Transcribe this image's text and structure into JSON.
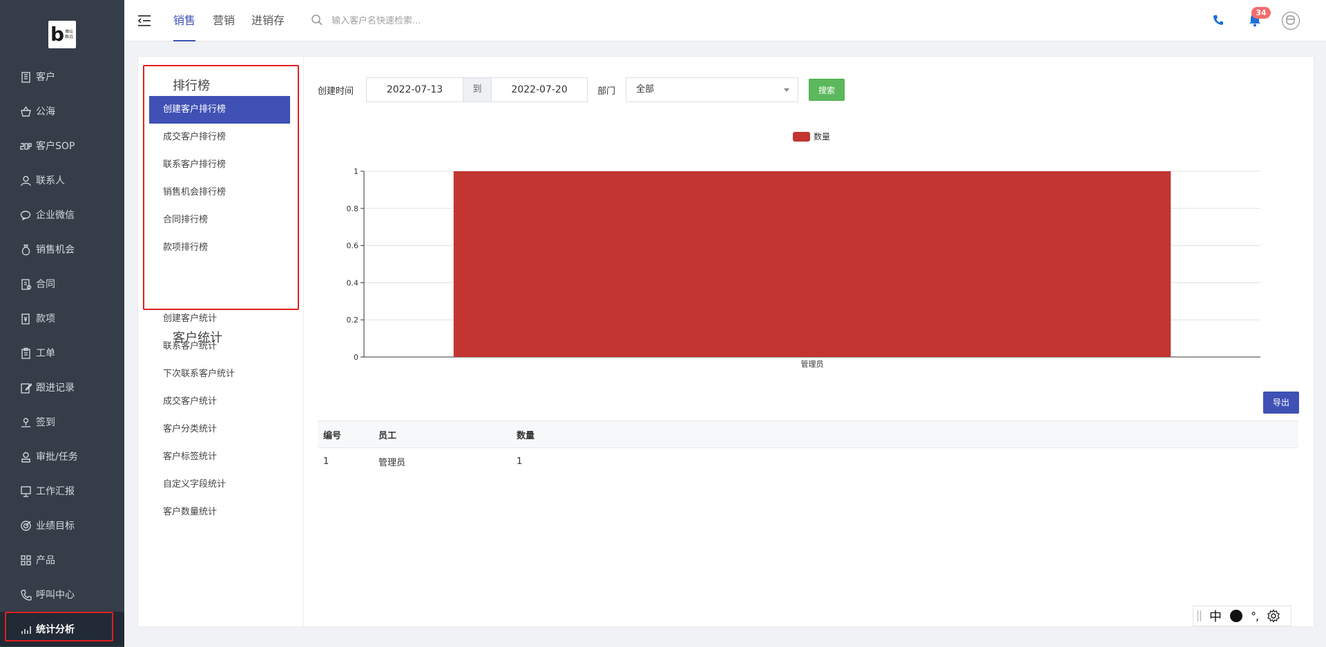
{
  "brand": {
    "logo_text": "博众致远"
  },
  "sidebar": {
    "items": [
      {
        "label": "客户",
        "icon": "building-icon"
      },
      {
        "label": "公海",
        "icon": "basket-icon"
      },
      {
        "label": "客户SOP",
        "icon": "sop-icon"
      },
      {
        "label": "联系人",
        "icon": "person-icon"
      },
      {
        "label": "企业微信",
        "icon": "wechat-icon"
      },
      {
        "label": "销售机会",
        "icon": "money-bag-icon"
      },
      {
        "label": "合同",
        "icon": "contract-icon"
      },
      {
        "label": "款项",
        "icon": "payment-icon"
      },
      {
        "label": "工单",
        "icon": "clipboard-icon"
      },
      {
        "label": "跟进记录",
        "icon": "edit-icon"
      },
      {
        "label": "签到",
        "icon": "location-icon"
      },
      {
        "label": "审批/任务",
        "icon": "approval-icon"
      },
      {
        "label": "工作汇报",
        "icon": "presentation-icon"
      },
      {
        "label": "业绩目标",
        "icon": "target-icon"
      },
      {
        "label": "产品",
        "icon": "grid-icon"
      },
      {
        "label": "呼叫中心",
        "icon": "phone-icon"
      },
      {
        "label": "统计分析",
        "icon": "bar-chart-icon",
        "active": true
      }
    ]
  },
  "topbar": {
    "tabs": [
      {
        "label": "销售",
        "active": true
      },
      {
        "label": "营销",
        "active": false
      },
      {
        "label": "进销存",
        "active": false
      }
    ],
    "search_placeholder": "输入客户名快速检索...",
    "notification_count": "34"
  },
  "left_panel": {
    "ranking_title": "排行榜",
    "ranking_items": [
      "创建客户排行榜",
      "成交客户排行榜",
      "联系客户排行榜",
      "销售机会排行榜",
      "合同排行榜",
      "款项排行榜"
    ],
    "active_ranking": 0,
    "stats_title": "客户统计",
    "stats_items": [
      "创建客户统计",
      "联系客户统计",
      "下次联系客户统计",
      "成交客户统计",
      "客户分类统计",
      "客户标签统计",
      "自定义字段统计",
      "客户数量统计"
    ]
  },
  "filters": {
    "created_label": "创建时间",
    "start_date": "2022-07-13",
    "range_sep": "到",
    "end_date": "2022-07-20",
    "dept_label": "部门",
    "dept_value": "全部",
    "search_button": "搜索"
  },
  "chart_data": {
    "type": "bar",
    "categories": [
      "管理员"
    ],
    "series": [
      {
        "name": "数量",
        "values": [
          1
        ],
        "color": "#c23531"
      }
    ],
    "ylim": [
      0,
      1
    ],
    "yticks": [
      "0",
      "0.2",
      "0.4",
      "0.6",
      "0.8",
      "1"
    ],
    "legend_position": "top-center",
    "grid": true
  },
  "table": {
    "export_button": "导出",
    "columns": [
      "编号",
      "员工",
      "数量"
    ],
    "rows": [
      [
        "1",
        "管理员",
        "1"
      ]
    ]
  },
  "ime": {
    "mode": "中",
    "punct": "°,"
  },
  "colors": {
    "accent": "#3f51b5",
    "sidebar_bg": "#353d48",
    "bar": "#c23531",
    "search_btn": "#5cb85c",
    "highlight": "#e02020"
  }
}
